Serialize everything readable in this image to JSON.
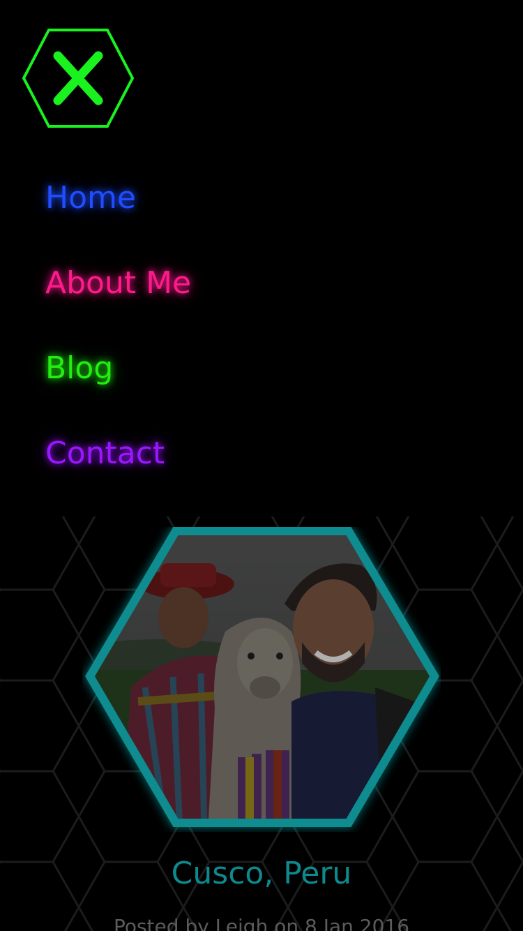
{
  "menu": {
    "close_icon": "close-x-hexagon-icon",
    "items": [
      {
        "label": "Home",
        "color": "#1f4dff"
      },
      {
        "label": "About Me",
        "color": "#ff1a8c"
      },
      {
        "label": "Blog",
        "color": "#22ee11"
      },
      {
        "label": "Contact",
        "color": "#9a16ff"
      }
    ]
  },
  "colors": {
    "background": "#000000",
    "close_accent": "#19f21e",
    "image_frame": "#0f8c90",
    "title": "#0d8a8e",
    "meta": "#5c5c5c"
  },
  "post": {
    "title": "Cusco, Peru",
    "meta": "Posted by Leigh on 8 Jan 2016"
  }
}
